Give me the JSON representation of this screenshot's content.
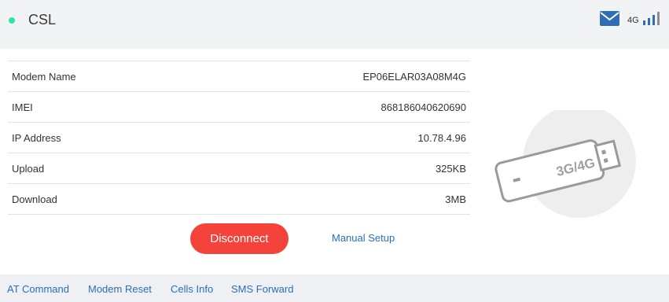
{
  "header": {
    "carrier": "CSL",
    "network_type": "4G",
    "colors": {
      "status_dot": "#2ee6a8",
      "accent": "#2f6eb5"
    },
    "icons": [
      "status-dot-icon",
      "mail-icon",
      "signal-bars-icon"
    ]
  },
  "info": {
    "rows": [
      {
        "label": "Modem Name",
        "value": "EP06ELAR03A08M4G"
      },
      {
        "label": "IMEI",
        "value": "868186040620690"
      },
      {
        "label": "IP Address",
        "value": "10.78.4.96"
      },
      {
        "label": "Upload",
        "value": "325KB"
      },
      {
        "label": "Download",
        "value": "3MB"
      }
    ]
  },
  "actions": {
    "disconnect_label": "Disconnect",
    "manual_setup_label": "Manual Setup",
    "disconnect_color": "#f4433a"
  },
  "illustration": {
    "label": "3G/4G",
    "icon": "usb-modem-icon"
  },
  "footer": {
    "links": [
      "AT Command",
      "Modem Reset",
      "Cells Info",
      "SMS Forward"
    ]
  }
}
